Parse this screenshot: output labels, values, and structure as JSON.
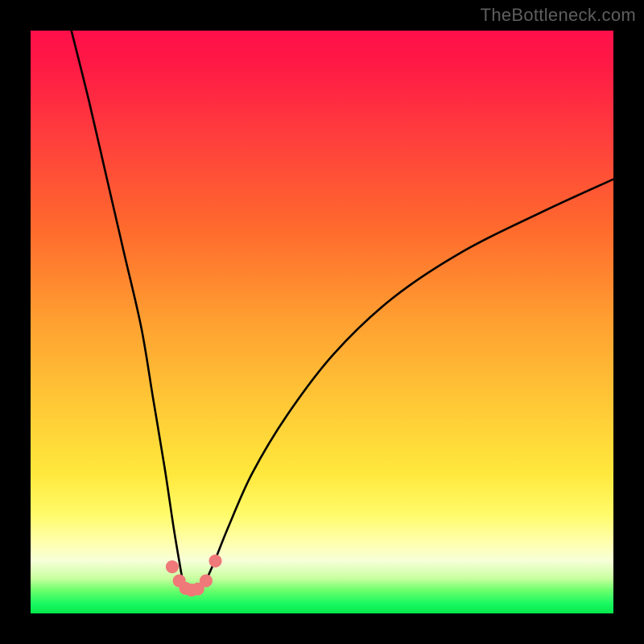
{
  "watermark": "TheBottleneck.com",
  "chart_data": {
    "type": "line",
    "title": "",
    "xlabel": "",
    "ylabel": "",
    "xlim": [
      0,
      100
    ],
    "ylim": [
      0,
      100
    ],
    "series": [
      {
        "name": "bottleneck-curve",
        "x": [
          7,
          10,
          13,
          16,
          19,
          21,
          23,
          24.5,
          25.5,
          26.2,
          27,
          28,
          29,
          30,
          31.5,
          34,
          38,
          44,
          52,
          62,
          74,
          88,
          100
        ],
        "values": [
          100,
          88,
          75,
          62,
          49,
          37,
          25,
          15,
          9,
          5.3,
          4.2,
          3.9,
          4.2,
          5.5,
          8.8,
          15,
          24,
          34,
          44.5,
          54,
          62,
          69,
          74.5
        ]
      }
    ],
    "markers": {
      "name": "optimum-points",
      "x": [
        24.3,
        25.5,
        26.6,
        27.6,
        28.7,
        30.1,
        31.7
      ],
      "values": [
        8.0,
        5.6,
        4.3,
        4.0,
        4.2,
        5.6,
        9.0
      ]
    },
    "colors": {
      "curve": "#000000",
      "marker": "#ef7878"
    }
  }
}
